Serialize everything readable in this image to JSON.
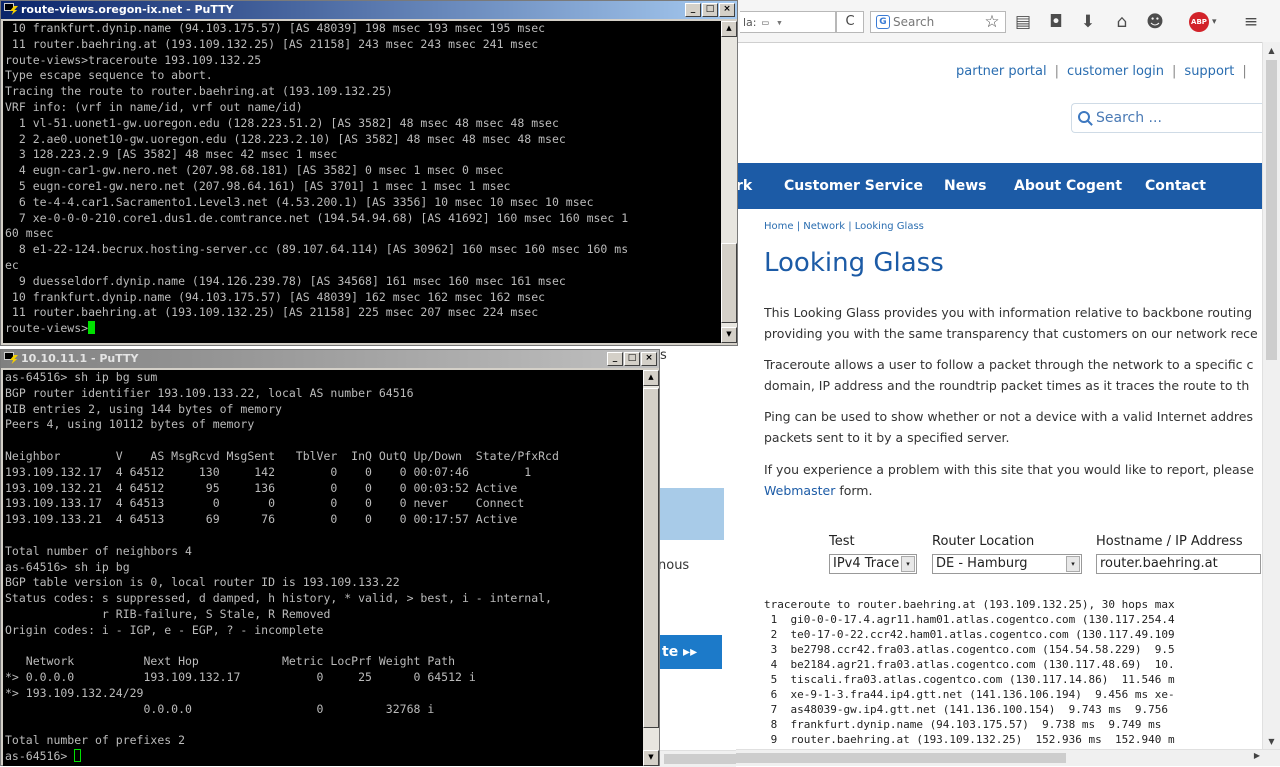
{
  "firefox": {
    "url_tail": "la:",
    "search_placeholder": "Search",
    "search_icon_label": "G",
    "abp_label": "ABP",
    "icons": {
      "reader": "▭",
      "dropdown": "▾",
      "reload": "C",
      "bookmark_star": "☆",
      "bookmarks_list": "▤",
      "pocket": "◘",
      "download": "⬇",
      "home": "⌂",
      "chat": "☻",
      "menu": "≡"
    }
  },
  "site": {
    "top_links": [
      "partner portal",
      "customer login",
      "support"
    ],
    "top_links_sep": "|",
    "search_placeholder": "Search ...",
    "nav": [
      "rk",
      "Customer Service",
      "News",
      "About Cogent",
      "Contact"
    ],
    "breadcrumb": "Home | Network | Looking Glass",
    "title": "Looking Glass",
    "paragraphs": [
      [
        "This Looking Glass provides you with information relative to backbone routing",
        "providing you with the same transparency that customers on our network rece"
      ],
      [
        "Traceroute allows a user to follow a packet through the network to a specific c",
        "domain, IP address and the roundtrip packet times as it traces the route to th"
      ],
      [
        "Ping can be used to show whether or not a device with a valid Internet addres",
        "packets sent to it by a specified server."
      ],
      [
        "If you experience a problem with this site that you would like to report, please"
      ]
    ],
    "webmaster_link": "Webmaster",
    "webmaster_suffix": " form.",
    "form": {
      "test_label": "Test",
      "test_value": "IPv4 Trace",
      "router_label": "Router Location",
      "router_value": "DE - Hamburg",
      "host_label": "Hostname / IP Address",
      "host_value": "router.baehring.at"
    },
    "traceroute_output": [
      "traceroute to router.baehring.at (193.109.132.25), 30 hops max",
      " 1  gi0-0-0-17.4.agr11.ham01.atlas.cogentco.com (130.117.254.4",
      " 2  te0-17-0-22.ccr42.ham01.atlas.cogentco.com (130.117.49.109",
      " 3  be2798.ccr42.fra03.atlas.cogentco.com (154.54.58.229)  9.5",
      " 4  be2184.agr21.fra03.atlas.cogentco.com (130.117.48.69)  10.",
      " 5  tiscali.fra03.atlas.cogentco.com (130.117.14.86)  11.546 m",
      " 6  xe-9-1-3.fra44.ip4.gtt.net (141.136.106.194)  9.456 ms xe-",
      " 7  as48039-gw.ip4.gtt.net (141.136.100.154)  9.743 ms  9.756 ",
      " 8  frankfurt.dynip.name (94.103.175.57)  9.738 ms  9.749 ms  ",
      " 9  router.baehring.at (193.109.132.25)  152.936 ms  152.940 m"
    ],
    "mid_text_s": "s",
    "mid_text_nous": "nous",
    "mid_button": "te ▸▸"
  },
  "putty1": {
    "title": "route-views.oregon-ix.net - PuTTY",
    "lines": [
      " 10 frankfurt.dynip.name (94.103.175.57) [AS 48039] 198 msec 193 msec 195 msec",
      " 11 router.baehring.at (193.109.132.25) [AS 21158] 243 msec 243 msec 241 msec",
      "route-views>traceroute 193.109.132.25",
      "Type escape sequence to abort.",
      "Tracing the route to router.baehring.at (193.109.132.25)",
      "VRF info: (vrf in name/id, vrf out name/id)",
      "  1 vl-51.uonet1-gw.uoregon.edu (128.223.51.2) [AS 3582] 48 msec 48 msec 48 msec",
      "  2 2.ae0.uonet10-gw.uoregon.edu (128.223.2.10) [AS 3582] 48 msec 48 msec 48 msec",
      "  3 128.223.2.9 [AS 3582] 48 msec 42 msec 1 msec",
      "  4 eugn-car1-gw.nero.net (207.98.68.181) [AS 3582] 0 msec 1 msec 0 msec",
      "  5 eugn-core1-gw.nero.net (207.98.64.161) [AS 3701] 1 msec 1 msec 1 msec",
      "  6 te-4-4.car1.Sacramento1.Level3.net (4.53.200.1) [AS 3356] 10 msec 10 msec 10 msec",
      "  7 xe-0-0-0-210.core1.dus1.de.comtrance.net (194.54.94.68) [AS 41692] 160 msec 160 msec 1",
      "60 msec",
      "  8 e1-22-124.becrux.hosting-server.cc (89.107.64.114) [AS 30962] 160 msec 160 msec 160 ms",
      "ec",
      "  9 duesseldorf.dynip.name (194.126.239.78) [AS 34568] 161 msec 160 msec 161 msec",
      " 10 frankfurt.dynip.name (94.103.175.57) [AS 48039] 162 msec 162 msec 162 msec",
      " 11 router.baehring.at (193.109.132.25) [AS 21158] 225 msec 207 msec 224 msec"
    ],
    "prompt": "route-views>"
  },
  "putty2": {
    "title": "10.10.11.1 - PuTTY",
    "lines": [
      "as-64516> sh ip bg sum",
      "BGP router identifier 193.109.133.22, local AS number 64516",
      "RIB entries 2, using 144 bytes of memory",
      "Peers 4, using 10112 bytes of memory",
      "",
      "Neighbor        V    AS MsgRcvd MsgSent   TblVer  InQ OutQ Up/Down  State/PfxRcd",
      "193.109.132.17  4 64512     130     142        0    0    0 00:07:46        1",
      "193.109.132.21  4 64512      95     136        0    0    0 00:03:52 Active",
      "193.109.133.17  4 64513       0       0        0    0    0 never    Connect",
      "193.109.133.21  4 64513      69      76        0    0    0 00:17:57 Active",
      "",
      "Total number of neighbors 4",
      "as-64516> sh ip bg",
      "BGP table version is 0, local router ID is 193.109.133.22",
      "Status codes: s suppressed, d damped, h history, * valid, > best, i - internal,",
      "              r RIB-failure, S Stale, R Removed",
      "Origin codes: i - IGP, e - EGP, ? - incomplete",
      "",
      "   Network          Next Hop            Metric LocPrf Weight Path",
      "*> 0.0.0.0          193.109.132.17           0     25      0 64512 i",
      "*> 193.109.132.24/29",
      "                    0.0.0.0                  0         32768 i",
      "",
      "Total number of prefixes 2"
    ],
    "prompt": "as-64516> "
  },
  "window_buttons": {
    "minimize": "_",
    "maximize": "□",
    "close": "×"
  },
  "scroll_arrows": {
    "up": "▲",
    "down": "▼",
    "right": "▶"
  }
}
